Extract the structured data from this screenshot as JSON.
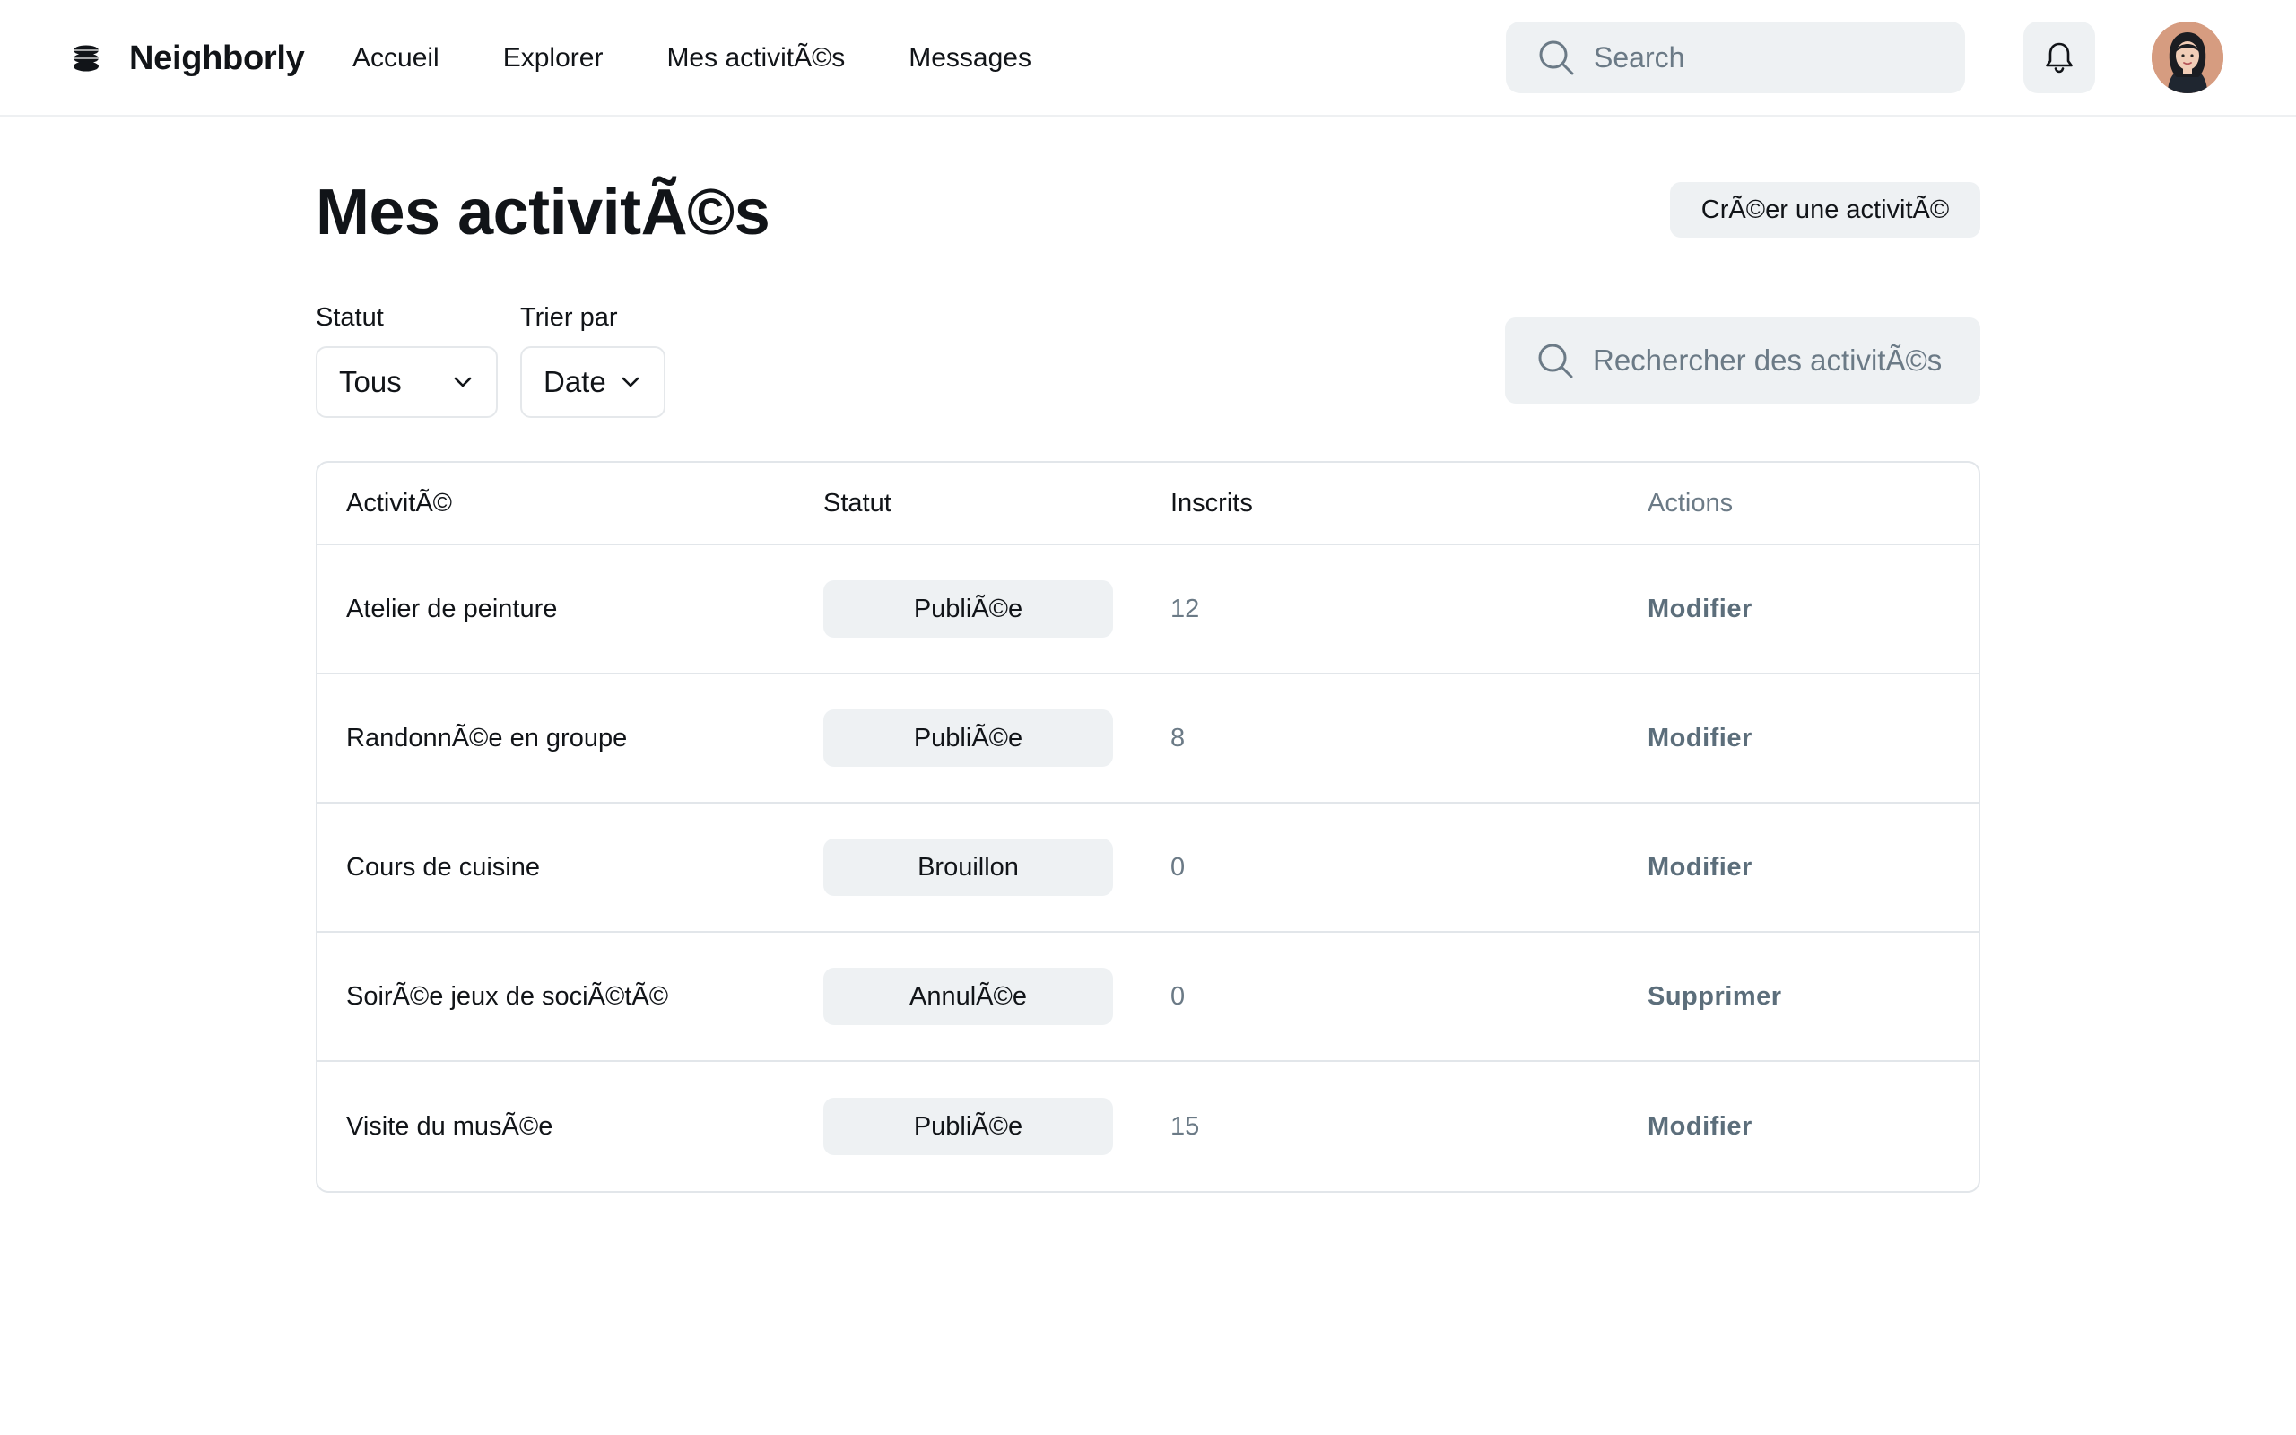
{
  "header": {
    "brand": "Neighborly",
    "nav": [
      "Accueil",
      "Explorer",
      "Mes activitÃ©s",
      "Messages"
    ],
    "search_placeholder": "Search"
  },
  "page": {
    "title": "Mes activitÃ©s",
    "create_button": "CrÃ©er une activitÃ©"
  },
  "filters": {
    "status_label": "Statut",
    "status_value": "Tous",
    "sort_label": "Trier par",
    "sort_value": "Date",
    "search_placeholder": "Rechercher des activitÃ©s"
  },
  "table": {
    "columns": [
      "ActivitÃ©",
      "Statut",
      "Inscrits",
      "Actions"
    ],
    "rows": [
      {
        "name": "Atelier de peinture",
        "status": "PubliÃ©e",
        "count": "12",
        "action": "Modifier"
      },
      {
        "name": "RandonnÃ©e en groupe",
        "status": "PubliÃ©e",
        "count": "8",
        "action": "Modifier"
      },
      {
        "name": "Cours de cuisine",
        "status": "Brouillon",
        "count": "0",
        "action": "Modifier"
      },
      {
        "name": "SoirÃ©e jeux de sociÃ©tÃ©",
        "status": "AnnulÃ©e",
        "count": "0",
        "action": "Supprimer"
      },
      {
        "name": "Visite du musÃ©e",
        "status": "PubliÃ©e",
        "count": "15",
        "action": "Modifier"
      }
    ]
  },
  "colors": {
    "accent_surface": "#eef1f3",
    "muted_text": "#6b7a86",
    "action_text": "#5c6e7b"
  }
}
